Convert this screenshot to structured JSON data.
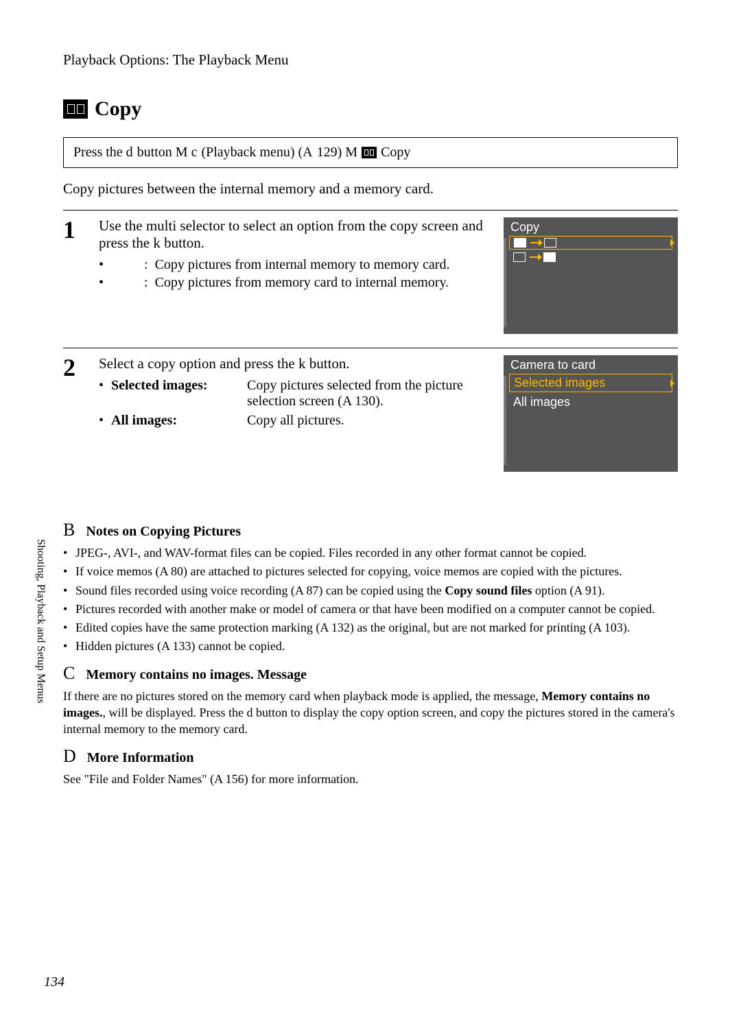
{
  "header": {
    "title": "Playback Options: The Playback Menu"
  },
  "section": {
    "icon": "copy-icon",
    "title": "Copy"
  },
  "breadcrumb": {
    "part1": "Press the d",
    "part2": "button M  c",
    "part3": "(Playback menu) (A",
    "part4": "129) M",
    "part5": "Copy"
  },
  "intro": "Copy pictures between the internal memory and a memory card.",
  "steps": [
    {
      "num": "1",
      "instr": "Use the multi selector to select an option from the copy screen and press the k    button.",
      "bullets": [
        {
          "label": "",
          "colon": ":",
          "desc": "Copy pictures from internal memory to memory card."
        },
        {
          "label": "",
          "colon": ":",
          "desc": "Copy pictures from memory card to internal memory."
        }
      ],
      "screenshot": {
        "title": "Copy",
        "row1": {
          "from": "in",
          "to": "card"
        },
        "row2": {
          "from": "card",
          "to": "in"
        }
      }
    },
    {
      "num": "2",
      "instr": "Select a copy option and press the k    button.",
      "options": [
        {
          "label": "Selected images",
          "colon": ":",
          "desc": "Copy pictures selected from the picture selection screen (A    130)."
        },
        {
          "label": "All images",
          "colon": ":",
          "desc": "Copy all pictures."
        }
      ],
      "screenshot": {
        "title": "Camera to card",
        "items": [
          "Selected images",
          "All images"
        ]
      }
    }
  ],
  "notes": [
    {
      "letter": "B",
      "title": "Notes on Copying Pictures",
      "items": [
        "JPEG-, AVI-, and WAV-format files can be copied. Files recorded in any other format cannot be copied.",
        "If voice memos (A    80) are attached to pictures selected for copying, voice memos are copied with the pictures.",
        "Sound files recorded using voice recording (A    87) can be copied using the <b>Copy sound files</b> option (A    91).",
        "Pictures recorded with another make or model of camera or that have been modified on a computer cannot be copied.",
        "Edited copies have the same protection marking (A    132) as the original, but are not marked for printing (A    103).",
        "Hidden pictures (A    133) cannot be copied."
      ]
    },
    {
      "letter": "C",
      "title": "Memory contains no images. Message",
      "body": "If there are no pictures stored on the memory card when playback mode is applied, the message, <b>Memory contains no images.</b>, will be displayed. Press the d       button to display the copy option screen, and copy the pictures stored in the camera's internal memory to the memory card."
    },
    {
      "letter": "D",
      "title": "More Information",
      "body": "See \"File and Folder Names\" (A    156) for more information."
    }
  ],
  "sidebar": "Shooting, Playback and Setup Menus",
  "page_num": "134"
}
